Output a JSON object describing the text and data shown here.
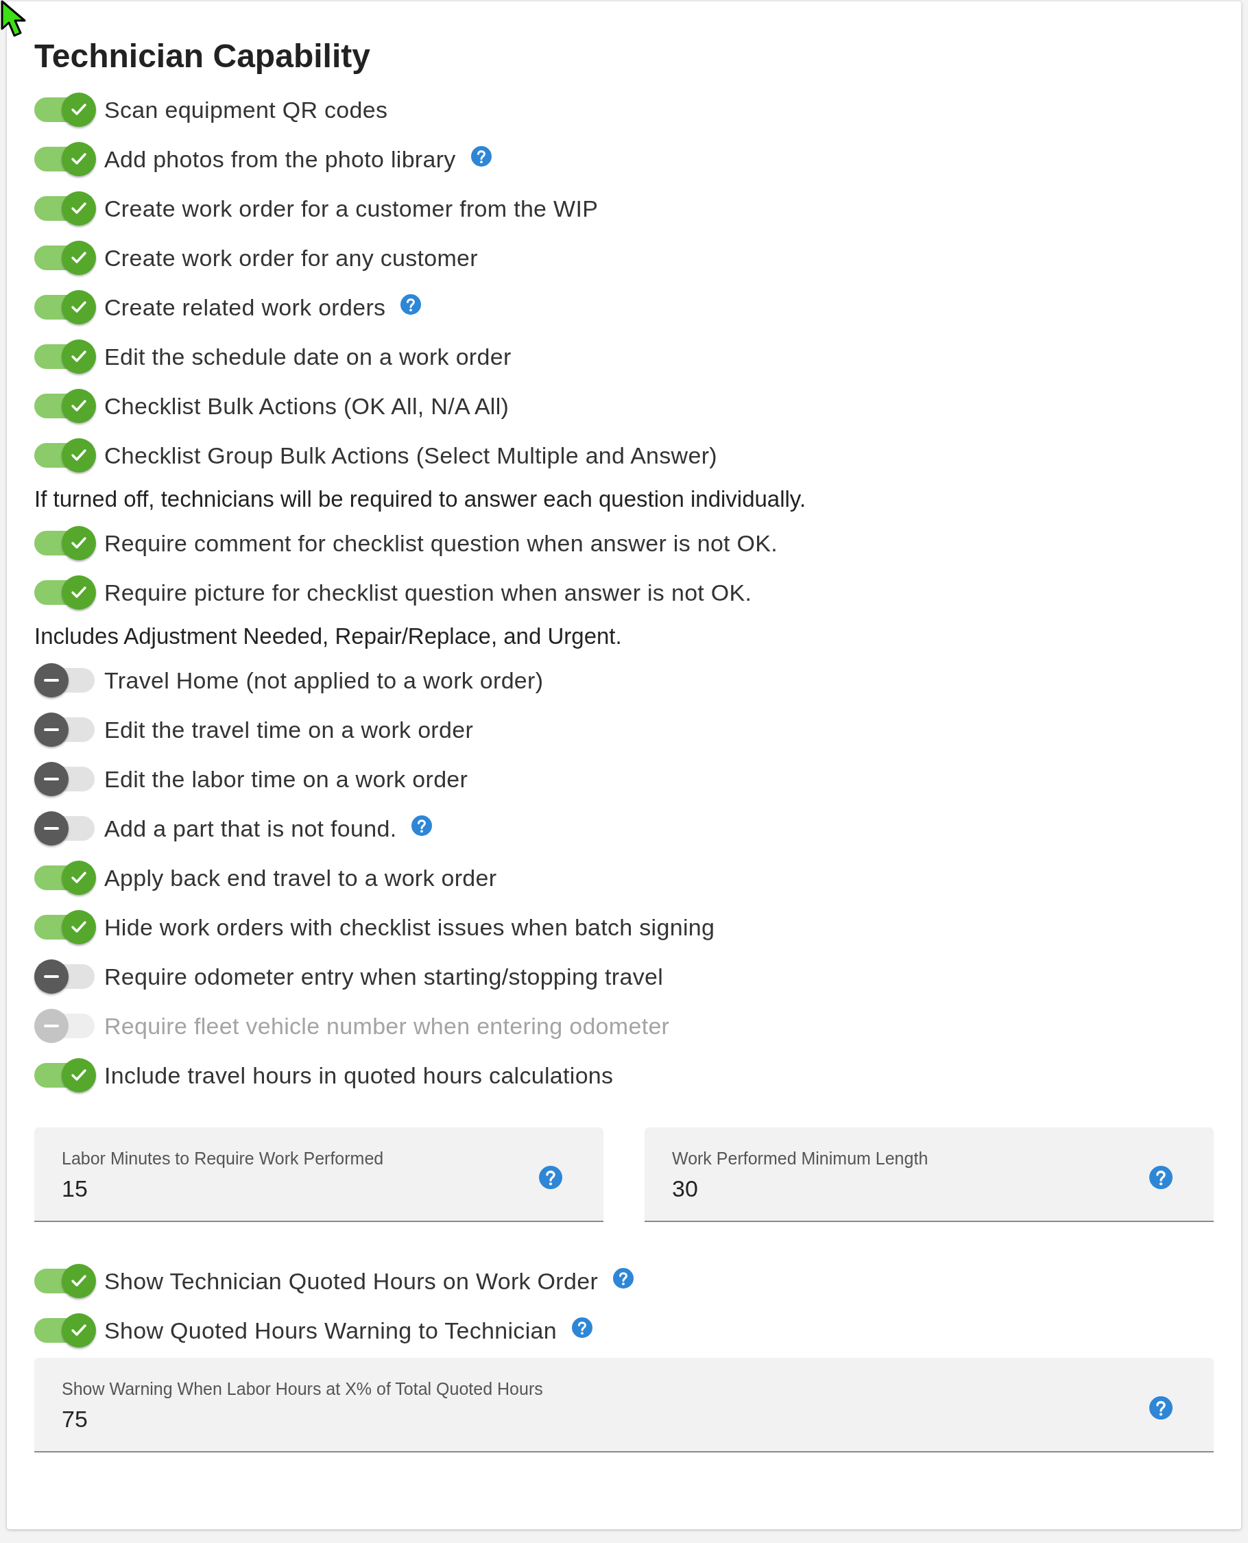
{
  "title": "Technician Capability",
  "items": [
    {
      "kind": "toggle",
      "label": "Scan equipment QR codes",
      "on": true,
      "disabled": false,
      "help": false
    },
    {
      "kind": "toggle",
      "label": "Add photos from the photo library",
      "on": true,
      "disabled": false,
      "help": true
    },
    {
      "kind": "toggle",
      "label": "Create work order for a customer from the WIP",
      "on": true,
      "disabled": false,
      "help": false
    },
    {
      "kind": "toggle",
      "label": "Create work order for any customer",
      "on": true,
      "disabled": false,
      "help": false
    },
    {
      "kind": "toggle",
      "label": "Create related work orders",
      "on": true,
      "disabled": false,
      "help": true
    },
    {
      "kind": "toggle",
      "label": "Edit the schedule date on a work order",
      "on": true,
      "disabled": false,
      "help": false
    },
    {
      "kind": "toggle",
      "label": "Checklist Bulk Actions (OK All, N/A All)",
      "on": true,
      "disabled": false,
      "help": false
    },
    {
      "kind": "toggle",
      "label": "Checklist Group Bulk Actions (Select Multiple and Answer)",
      "on": true,
      "disabled": false,
      "help": false
    },
    {
      "kind": "note",
      "label": "If turned off, technicians will be required to answer each question individually."
    },
    {
      "kind": "toggle",
      "label": "Require comment for checklist question when answer is not OK.",
      "on": true,
      "disabled": false,
      "help": false
    },
    {
      "kind": "toggle",
      "label": "Require picture for checklist question when answer is not OK.",
      "on": true,
      "disabled": false,
      "help": false
    },
    {
      "kind": "note",
      "label": "Includes Adjustment Needed, Repair/Replace, and Urgent."
    },
    {
      "kind": "toggle",
      "label": "Travel Home (not applied to a work order)",
      "on": false,
      "disabled": false,
      "help": false
    },
    {
      "kind": "toggle",
      "label": "Edit the travel time on a work order",
      "on": false,
      "disabled": false,
      "help": false
    },
    {
      "kind": "toggle",
      "label": "Edit the labor time on a work order",
      "on": false,
      "disabled": false,
      "help": false
    },
    {
      "kind": "toggle",
      "label": "Add a part that is not found.",
      "on": false,
      "disabled": false,
      "help": true
    },
    {
      "kind": "toggle",
      "label": "Apply back end travel to a work order",
      "on": true,
      "disabled": false,
      "help": false
    },
    {
      "kind": "toggle",
      "label": "Hide work orders with checklist issues when batch signing",
      "on": true,
      "disabled": false,
      "help": false
    },
    {
      "kind": "toggle",
      "label": "Require odometer entry when starting/stopping travel",
      "on": false,
      "disabled": false,
      "help": false
    },
    {
      "kind": "toggle",
      "label": "Require fleet vehicle number when entering odometer",
      "on": false,
      "disabled": true,
      "help": false
    },
    {
      "kind": "toggle",
      "label": "Include travel hours in quoted hours calculations",
      "on": true,
      "disabled": false,
      "help": false
    },
    {
      "kind": "fields",
      "fields": [
        {
          "label": "Labor Minutes to Require Work Performed",
          "value": "15"
        },
        {
          "label": "Work Performed Minimum Length",
          "value": "30"
        }
      ]
    },
    {
      "kind": "toggle",
      "label": "Show Technician Quoted Hours on Work Order",
      "on": true,
      "disabled": false,
      "help": true
    },
    {
      "kind": "toggle",
      "label": "Show Quoted Hours Warning to Technician",
      "on": true,
      "disabled": false,
      "help": true
    },
    {
      "kind": "fields",
      "fields": [
        {
          "label": "Show Warning When Labor Hours at X% of Total Quoted Hours",
          "value": "75"
        }
      ]
    }
  ]
}
